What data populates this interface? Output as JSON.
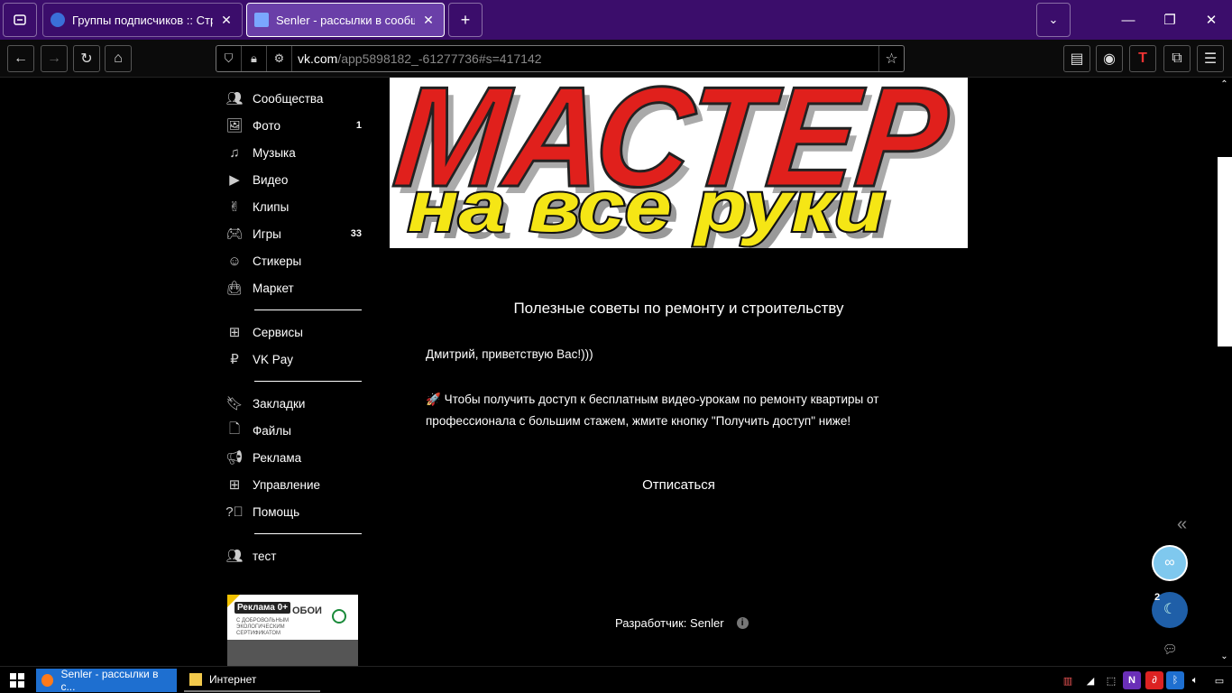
{
  "browser": {
    "tabs": [
      {
        "title": "Группы подписчиков :: Строи",
        "close": "✕"
      },
      {
        "title": "Senler - рассылки в сообщест",
        "close": "✕"
      }
    ],
    "new_tab": "+",
    "url_domain": "vk.com",
    "url_path": "/app5898182_-61277736#s=417142"
  },
  "sidebar": {
    "items": [
      {
        "label": "Сообщества",
        "count": "",
        "icon": "people-icon"
      },
      {
        "label": "Фото",
        "count": "1",
        "icon": "photo-icon"
      },
      {
        "label": "Музыка",
        "count": "",
        "icon": "music-icon"
      },
      {
        "label": "Видео",
        "count": "",
        "icon": "video-icon"
      },
      {
        "label": "Клипы",
        "count": "",
        "icon": "clips-icon"
      },
      {
        "label": "Игры",
        "count": "33",
        "icon": "gamepad-icon"
      },
      {
        "label": "Стикеры",
        "count": "",
        "icon": "smile-icon"
      },
      {
        "label": "Маркет",
        "count": "",
        "icon": "bag-icon"
      }
    ],
    "items2": [
      {
        "label": "Сервисы",
        "icon": "grid-icon"
      },
      {
        "label": "VK Pay",
        "icon": "vkpay-icon"
      }
    ],
    "items3": [
      {
        "label": "Закладки",
        "icon": "bookmark-icon"
      },
      {
        "label": "Файлы",
        "icon": "file-icon"
      },
      {
        "label": "Реклама",
        "icon": "megaphone-icon"
      },
      {
        "label": "Управление",
        "icon": "grid-icon"
      },
      {
        "label": "Помощь",
        "icon": "help-icon"
      }
    ],
    "items4": [
      {
        "label": "тест",
        "icon": "people-icon"
      }
    ]
  },
  "ad": {
    "tag": "Реклама 0+",
    "headline": "ОБОИ",
    "text": "С ДОБРОВОЛЬНЫМ ЭКОЛОГИЧЕСКИМ СЕРТИФИКАТОМ"
  },
  "banner": {
    "line1": "МАСТЕР",
    "line2": "на все руки"
  },
  "main": {
    "group_title": "Полезные советы по ремонту и строительству",
    "greeting": "Дмитрий, приветствую Вас!)))",
    "description": "Чтобы получить доступ к бесплатным видео-урокам по ремонту квартиры от профессионала с большим стажем, жмите кнопку \"Получить доступ\" ниже!",
    "rocket": "🚀",
    "unsubscribe": "Отписаться",
    "developer": "Разработчик: Senler"
  },
  "floating": {
    "collapse": "«",
    "badge_count": "2"
  },
  "taskbar": {
    "items": [
      {
        "label": "Senler - рассылки в с..."
      },
      {
        "label": "Интернет"
      }
    ]
  }
}
